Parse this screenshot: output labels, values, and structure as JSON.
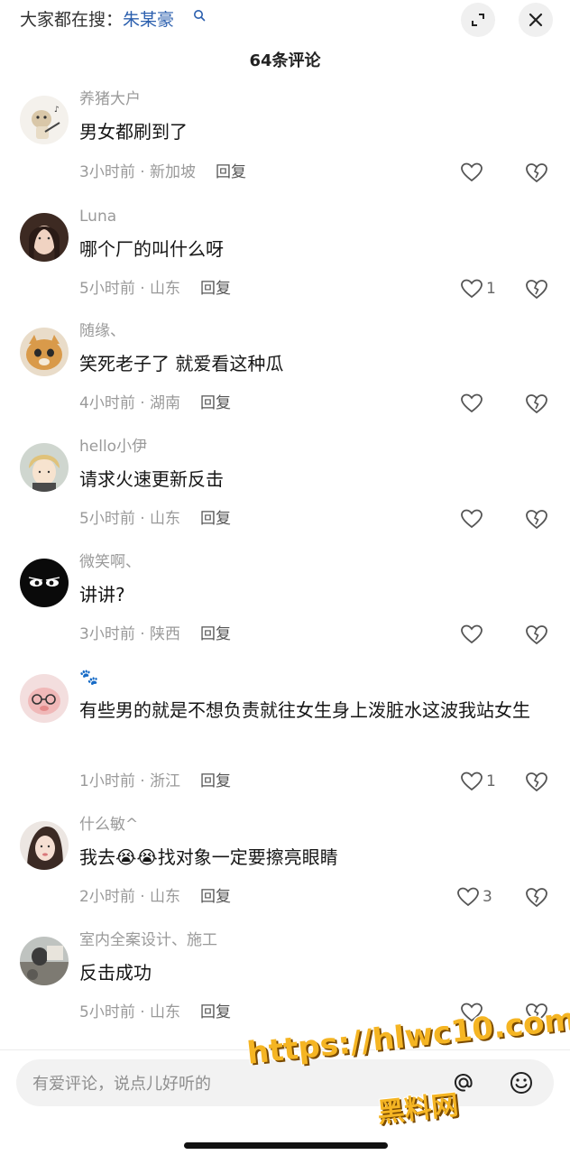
{
  "header": {
    "search_prefix": "大家都在搜：",
    "search_term": "朱某豪",
    "comment_count": "64条评论"
  },
  "comments": [
    {
      "user": "养猪大户",
      "text": "男女都刷到了",
      "time": "3小时前 · 新加坡",
      "reply": "回复",
      "likes": ""
    },
    {
      "user": "Luna",
      "text": "哪个厂的叫什么呀",
      "time": "5小时前 · 山东",
      "reply": "回复",
      "likes": "1"
    },
    {
      "user": "随缘、",
      "text": "笑死老子了 就爱看这种瓜",
      "time": "4小时前 · 湖南",
      "reply": "回复",
      "likes": ""
    },
    {
      "user": "hello小伊",
      "text": "请求火速更新反击",
      "time": "5小时前 · 山东",
      "reply": "回复",
      "likes": ""
    },
    {
      "user": "微笑啊、",
      "text": "讲讲?",
      "time": "3小时前 · 陕西",
      "reply": "回复",
      "likes": ""
    },
    {
      "user": "🐾",
      "text": "有些男的就是不想负责就往女生身上泼脏水这波我站女生",
      "time": "1小时前 · 浙江",
      "reply": "回复",
      "likes": "1"
    },
    {
      "user": "什么敏^",
      "text": "我去😭😭找对象一定要擦亮眼睛",
      "time": "2小时前 · 山东",
      "reply": "回复",
      "likes": "3"
    },
    {
      "user": "室内全案设计、施工",
      "text": "反击成功",
      "time": "5小时前 · 山东",
      "reply": "回复",
      "likes": ""
    }
  ],
  "input": {
    "placeholder": "有爱评论，说点儿好听的"
  },
  "watermark": {
    "line1": "https://hlwc10.com",
    "line2": "黑料网"
  },
  "icons": {
    "expand": "expand-icon",
    "close": "close-icon",
    "like": "heart-icon",
    "dislike": "broken-heart-icon",
    "mention": "at-icon",
    "emoji": "emoji-icon"
  },
  "colors": {
    "search_term": "#2b5fae",
    "watermark": "#f5b523"
  }
}
